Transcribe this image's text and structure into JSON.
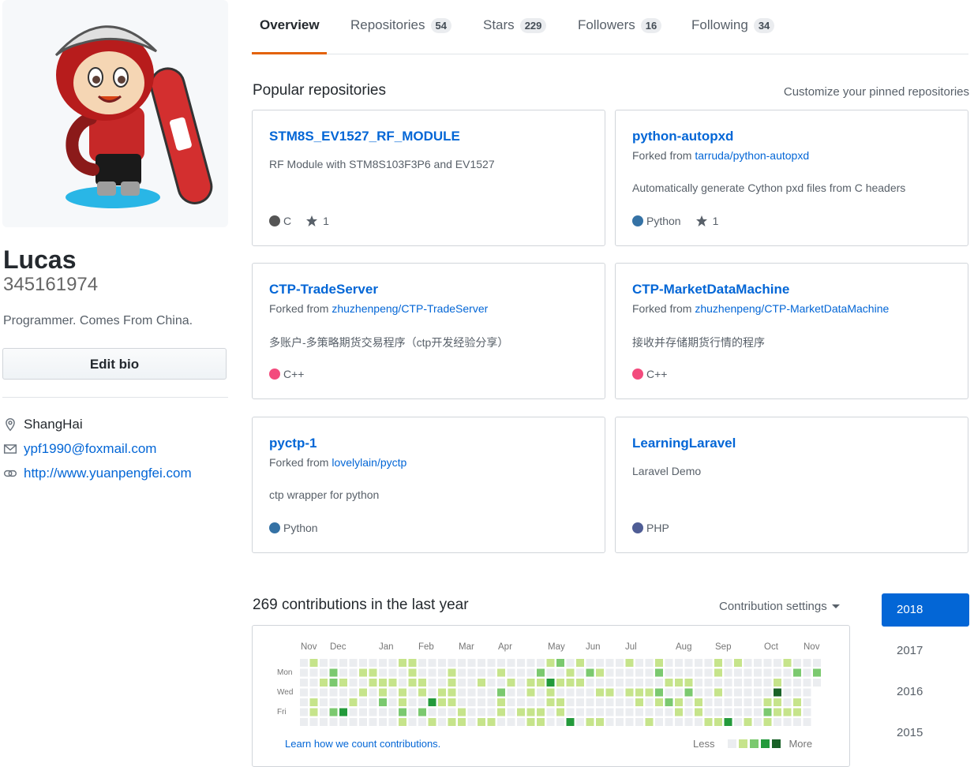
{
  "profile": {
    "name": "Lucas",
    "login": "345161974",
    "bio": "Programmer. Comes From China.",
    "edit_bio_label": "Edit bio",
    "location": "ShangHai",
    "email": "ypf1990@foxmail.com",
    "website": "http://www.yuanpengfei.com"
  },
  "tabs": [
    {
      "label": "Overview",
      "count": null,
      "selected": true
    },
    {
      "label": "Repositories",
      "count": "54"
    },
    {
      "label": "Stars",
      "count": "229"
    },
    {
      "label": "Followers",
      "count": "16"
    },
    {
      "label": "Following",
      "count": "34"
    }
  ],
  "popular": {
    "title": "Popular repositories",
    "customize": "Customize your pinned repositories",
    "forked_prefix": "Forked from ",
    "repos": [
      {
        "name": "STM8S_EV1527_RF_MODULE",
        "forked_from": "",
        "description": "RF Module with STM8S103F3P6 and EV1527",
        "language": "C",
        "lang_color": "#555555",
        "stars": "1"
      },
      {
        "name": "python-autopxd",
        "forked_from": "tarruda/python-autopxd",
        "description": "Automatically generate Cython pxd files from C headers",
        "language": "Python",
        "lang_color": "#3572A5",
        "stars": "1"
      },
      {
        "name": "CTP-TradeServer",
        "forked_from": "zhuzhenpeng/CTP-TradeServer",
        "description": "多账户-多策略期货交易程序（ctp开发经验分享）",
        "language": "C++",
        "lang_color": "#f34b7d",
        "stars": ""
      },
      {
        "name": "CTP-MarketDataMachine",
        "forked_from": "zhuzhenpeng/CTP-MarketDataMachine",
        "description": "接收并存储期货行情的程序",
        "language": "C++",
        "lang_color": "#f34b7d",
        "stars": ""
      },
      {
        "name": "pyctp-1",
        "forked_from": "lovelylain/pyctp",
        "description": "ctp wrapper for python",
        "language": "Python",
        "lang_color": "#3572A5",
        "stars": ""
      },
      {
        "name": "LearningLaravel",
        "forked_from": "",
        "description": "Laravel Demo",
        "language": "PHP",
        "lang_color": "#4F5D95",
        "stars": ""
      }
    ]
  },
  "contributions": {
    "title": "269 contributions in the last year",
    "settings_label": "Contribution settings",
    "months": [
      "Nov",
      "Dec",
      "Jan",
      "Feb",
      "Mar",
      "Apr",
      "May",
      "Jun",
      "Jul",
      "Aug",
      "Sep",
      "Oct",
      "Nov"
    ],
    "day_labels": [
      "Mon",
      "Wed",
      "Fri"
    ],
    "learn_link": "Learn how we count contributions.",
    "legend_less": "Less",
    "legend_more": "More",
    "colors": [
      "#ebedf0",
      "#c6e48b",
      "#7bc96f",
      "#239a3b",
      "#196127"
    ]
  },
  "years": [
    "2018",
    "2017",
    "2016",
    "2015"
  ]
}
